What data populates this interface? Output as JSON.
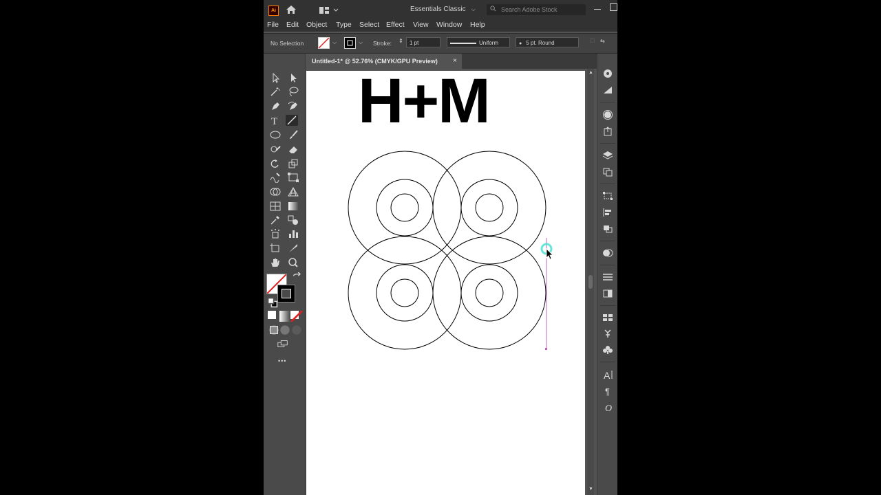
{
  "app": {
    "logo": "Ai",
    "workspace": "Essentials Classic",
    "search_placeholder": "Search Adobe Stock"
  },
  "menu": [
    "File",
    "Edit",
    "Object",
    "Type",
    "Select",
    "Effect",
    "View",
    "Window",
    "Help"
  ],
  "control_bar": {
    "selection_label": "No Selection",
    "stroke_label": "Stroke:",
    "stroke_weight": "1 pt",
    "stroke_profile": "Uniform",
    "brush": "5 pt. Round"
  },
  "document": {
    "tab_title": "Untitled-1* @ 52.76% (CMYK/GPU Preview)",
    "close_glyph": "×"
  },
  "artboard": {
    "title": "H+M"
  },
  "toolbar": {
    "more_glyph": "•••",
    "tools": [
      "selection-tool",
      "direct-selection-tool",
      "magic-wand-tool",
      "lasso-tool",
      "pen-tool",
      "curvature-tool",
      "type-tool",
      "line-segment-tool",
      "ellipse-tool",
      "paintbrush-tool",
      "shaper-tool",
      "eraser-tool",
      "rotate-tool",
      "scale-tool",
      "warp-tool",
      "free-transform-tool",
      "shape-builder-tool",
      "perspective-grid-tool",
      "mesh-tool",
      "gradient-tool",
      "eyedropper-tool",
      "blend-tool",
      "symbol-sprayer-tool",
      "column-graph-tool",
      "artboard-tool",
      "slice-tool",
      "hand-tool",
      "zoom-tool"
    ],
    "active_tool": "line-segment-tool"
  },
  "dock_panels": [
    "color-guide-icon",
    "gradient-icon",
    "appearance-icon",
    "export-icon",
    "layers-icon",
    "artboards-icon",
    "transform-icon",
    "align-icon",
    "pathfinder-icon",
    "color-icon",
    "stroke-icon",
    "transparency-icon",
    "swatches-icon",
    "symbols-icon",
    "brushes-icon",
    "character-icon",
    "paragraph-icon",
    "opentype-icon"
  ],
  "colors": {
    "app_bg": "#535353",
    "toolbar_bg": "#4a4a4a",
    "titlebar_bg": "#323232",
    "guide_magenta": "#c060c0",
    "cursor_cyan": "#40e0d0"
  }
}
